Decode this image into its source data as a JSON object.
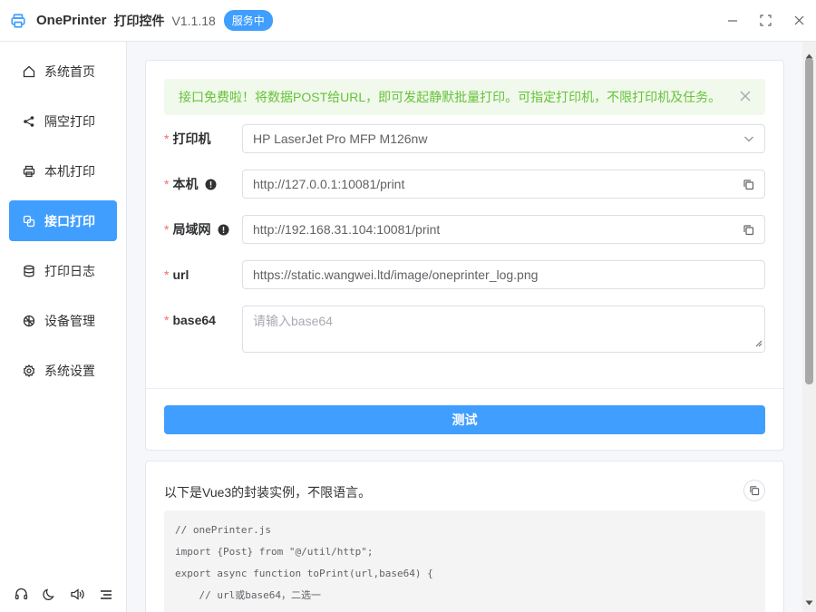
{
  "titlebar": {
    "app_name": "OnePrinter",
    "app_subtitle": "打印控件",
    "version": "V1.1.18",
    "status_badge": "服务中",
    "logo_icon": "printer-icon",
    "controls": [
      "minimize-icon",
      "maximize-icon",
      "close-icon"
    ]
  },
  "sidebar": {
    "items": [
      {
        "label": "系统首页",
        "icon": "home-icon"
      },
      {
        "label": "隔空打印",
        "icon": "share-icon"
      },
      {
        "label": "本机打印",
        "icon": "printer-icon"
      },
      {
        "label": "接口打印",
        "icon": "api-icon",
        "active": true
      },
      {
        "label": "打印日志",
        "icon": "database-icon"
      },
      {
        "label": "设备管理",
        "icon": "device-icon"
      },
      {
        "label": "系统设置",
        "icon": "gear-icon"
      }
    ],
    "bottom_icons": [
      "headset-icon",
      "moon-icon",
      "speaker-icon",
      "menu-icon"
    ]
  },
  "alert": {
    "text": "接口免费啦！将数据POST给URL，即可发起静默批量打印。可指定打印机，不限打印机及任务。"
  },
  "form": {
    "printer": {
      "label": "打印机",
      "value": "HP LaserJet Pro MFP M126nw"
    },
    "local": {
      "label": "本机",
      "value": "http://127.0.0.1:10081/print"
    },
    "lan": {
      "label": "局域网",
      "value": "http://192.168.31.104:10081/print"
    },
    "url": {
      "label": "url",
      "value": "https://static.wangwei.ltd/image/oneprinter_log.png"
    },
    "base64": {
      "label": "base64",
      "placeholder": "请输入base64",
      "value": ""
    }
  },
  "test_button": "测试",
  "example": {
    "title": "以下是Vue3的封装实例，不限语言。",
    "code_lines": [
      "// onePrinter.js",
      "import {Post} from \"@/util/http\";",
      "export async function toPrint(url,base64) {",
      "    // url或base64，二选一"
    ]
  },
  "colors": {
    "primary": "#409eff",
    "success_text": "#67c23a",
    "success_bg": "#f0f9eb",
    "required": "#f56c6c"
  }
}
